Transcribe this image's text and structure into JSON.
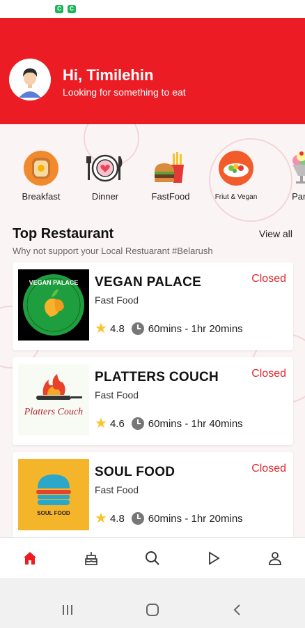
{
  "colors": {
    "brand": "#ec1c24",
    "status_closed": "#e0282e",
    "star": "#f7c52b"
  },
  "header": {
    "greeting": "Hi, Timilehin",
    "subtitle": "Looking for something to eat"
  },
  "categories": [
    {
      "label": "Breakfast",
      "icon": "breakfast-toast-icon"
    },
    {
      "label": "Dinner",
      "icon": "dinner-plate-icon"
    },
    {
      "label": "FastFood",
      "icon": "burger-fries-icon"
    },
    {
      "label": "Friut & Vegan",
      "icon": "salad-bowl-icon"
    },
    {
      "label": "Parf",
      "icon": "parfait-icon"
    }
  ],
  "section": {
    "title": "Top Restaurant",
    "view_all": "View all",
    "subtitle": "Why not support your Local Restuarant #Belarush"
  },
  "restaurants": [
    {
      "name": "VEGAN PALACE",
      "category": "Fast Food",
      "status": "Closed",
      "rating": "4.8",
      "time": "60mins - 1hr 20mins",
      "logo_text": "VEGAN PALACE"
    },
    {
      "name": "PLATTERS COUCH",
      "category": "Fast Food",
      "status": "Closed",
      "rating": "4.6",
      "time": "60mins - 1hr 40mins",
      "logo_text": "Platters Couch"
    },
    {
      "name": "SOUL FOOD",
      "category": "Fast Food",
      "status": "Closed",
      "rating": "4.8",
      "time": "60mins - 1hr 20mins",
      "logo_text": "SOUL FOOD"
    }
  ],
  "bottom_nav": [
    {
      "icon": "home-icon",
      "active": true
    },
    {
      "icon": "cake-icon",
      "active": false
    },
    {
      "icon": "search-icon",
      "active": false
    },
    {
      "icon": "play-icon",
      "active": false
    },
    {
      "icon": "profile-icon",
      "active": false
    }
  ]
}
